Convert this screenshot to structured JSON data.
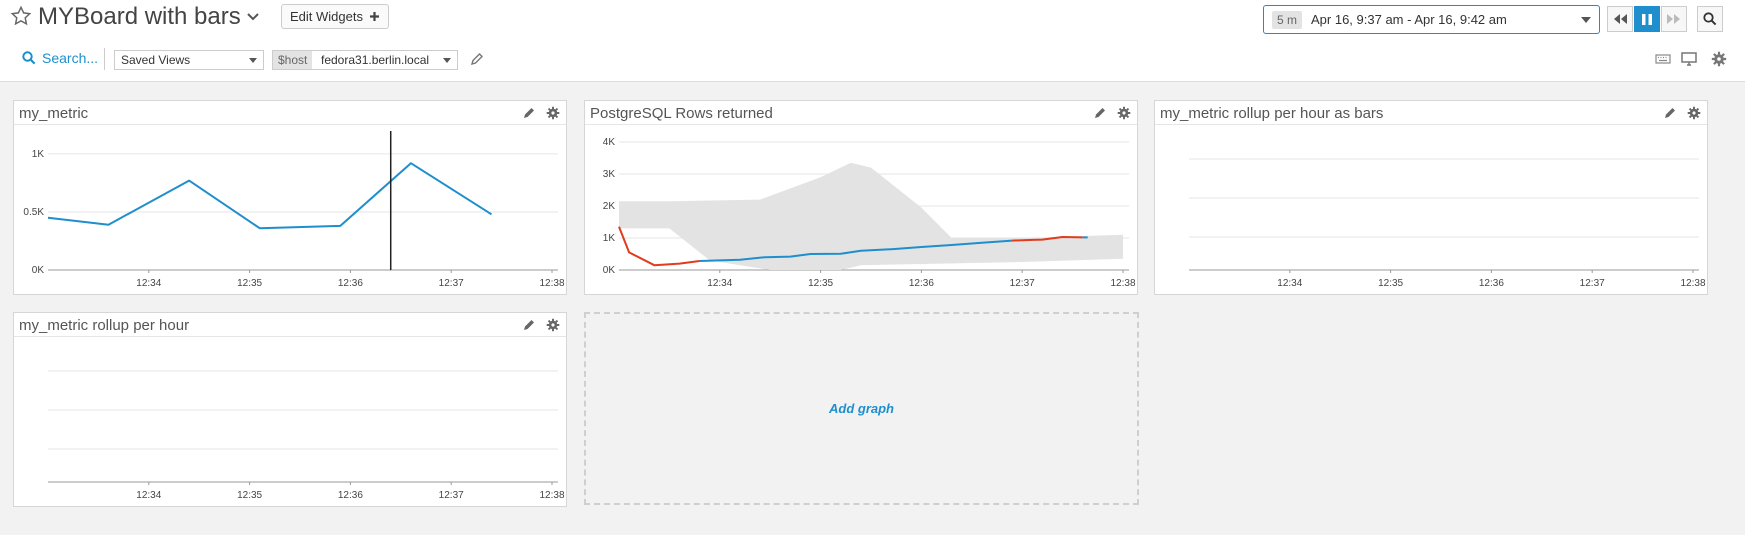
{
  "header": {
    "title": "MYBoard with bars",
    "edit_widgets_label": "Edit Widgets",
    "time_chip": "5 m",
    "time_range": "Apr 16, 9:37 am - Apr 16, 9:42 am",
    "search_label": "Search...",
    "saved_views_label": "Saved Views",
    "host_var_label": "$host",
    "host_value": "fedora31.berlin.local"
  },
  "icons": {
    "star": "star-outline-icon",
    "rewind": "rewind-icon",
    "pause": "pause-icon",
    "forward": "fast-forward-icon",
    "zoom": "zoom-icon",
    "keyboard": "keyboard-icon",
    "monitor": "monitor-icon",
    "settings": "gear-icon"
  },
  "colors": {
    "accent": "#1e8fcc",
    "series_blue": "#1e8fcc",
    "series_red": "#e03c1d",
    "band": "#e3e3e3",
    "cursor": "#222222"
  },
  "widgets": [
    {
      "id": "my-metric",
      "title": "my_metric"
    },
    {
      "id": "postgres-rows",
      "title": "PostgreSQL Rows returned"
    },
    {
      "id": "rollup-bars",
      "title": "my_metric rollup per hour as bars"
    },
    {
      "id": "rollup",
      "title": "my_metric rollup per hour"
    }
  ],
  "add_graph_label": "Add graph",
  "chart_data": [
    {
      "type": "line",
      "widget": "my_metric",
      "x_ticks": [
        "12:34",
        "12:35",
        "12:36",
        "12:37",
        "12:38"
      ],
      "y_ticks": [
        "0K",
        "0.5K",
        "1K"
      ],
      "ylim": [
        0,
        1000
      ],
      "cursor_x": "12:36.4",
      "series": [
        {
          "color": "#1e8fcc",
          "points": [
            [
              "12:33.0",
              450
            ],
            [
              "12:33.6",
              390
            ],
            [
              "12:34.4",
              770
            ],
            [
              "12:35.1",
              360
            ],
            [
              "12:35.9",
              380
            ],
            [
              "12:36.6",
              920
            ],
            [
              "12:37.4",
              480
            ]
          ]
        }
      ]
    },
    {
      "type": "line",
      "widget": "PostgreSQL Rows returned",
      "x_ticks": [
        "12:34",
        "12:35",
        "12:36",
        "12:37",
        "12:38"
      ],
      "y_ticks": [
        "0K",
        "1K",
        "2K",
        "3K",
        "4K"
      ],
      "ylim": [
        0,
        4000
      ],
      "band": {
        "upper": [
          [
            "12:33.0",
            2150
          ],
          [
            "12:33.5",
            2150
          ],
          [
            "12:34.4",
            2200
          ],
          [
            "12:35.0",
            2900
          ],
          [
            "12:35.3",
            3350
          ],
          [
            "12:35.5",
            3200
          ],
          [
            "12:36.0",
            1950
          ],
          [
            "12:36.3",
            1000
          ],
          [
            "12:37.0",
            1000
          ],
          [
            "12:38.0",
            1100
          ]
        ],
        "lower": [
          [
            "12:33.0",
            1300
          ],
          [
            "12:33.5",
            1300
          ],
          [
            "12:33.9",
            300
          ],
          [
            "12:34.5",
            0
          ],
          [
            "12:35.2",
            0
          ],
          [
            "12:35.4",
            150
          ],
          [
            "12:36.2",
            200
          ],
          [
            "12:37.0",
            250
          ],
          [
            "12:38.0",
            350
          ]
        ]
      },
      "series": [
        {
          "color": "#e03c1d",
          "points": [
            [
              "12:33.0",
              1350
            ],
            [
              "12:33.1",
              550
            ],
            [
              "12:33.35",
              150
            ],
            [
              "12:33.6",
              200
            ],
            [
              "12:33.8",
              280
            ]
          ]
        },
        {
          "color": "#1e8fcc",
          "points": [
            [
              "12:33.8",
              280
            ],
            [
              "12:34.2",
              320
            ],
            [
              "12:34.45",
              400
            ],
            [
              "12:34.7",
              420
            ],
            [
              "12:34.9",
              500
            ],
            [
              "12:35.2",
              510
            ],
            [
              "12:35.4",
              600
            ],
            [
              "12:35.7",
              650
            ],
            [
              "12:36.0",
              720
            ],
            [
              "12:36.3",
              780
            ],
            [
              "12:36.6",
              850
            ],
            [
              "12:36.9",
              920
            ]
          ]
        },
        {
          "color": "#e03c1d",
          "points": [
            [
              "12:36.9",
              920
            ],
            [
              "12:37.1",
              940
            ],
            [
              "12:37.2",
              950
            ],
            [
              "12:37.4",
              1030
            ],
            [
              "12:37.6",
              1020
            ]
          ]
        },
        {
          "color": "#1e8fcc",
          "points": [
            [
              "12:37.6",
              1020
            ],
            [
              "12:37.65",
              1020
            ]
          ]
        }
      ]
    },
    {
      "type": "bar",
      "widget": "my_metric rollup per hour as bars",
      "x_ticks": [
        "12:34",
        "12:35",
        "12:36",
        "12:37",
        "12:38"
      ],
      "y_ticks": [],
      "series": []
    },
    {
      "type": "line",
      "widget": "my_metric rollup per hour",
      "x_ticks": [
        "12:34",
        "12:35",
        "12:36",
        "12:37",
        "12:38"
      ],
      "y_ticks": [],
      "series": []
    }
  ]
}
